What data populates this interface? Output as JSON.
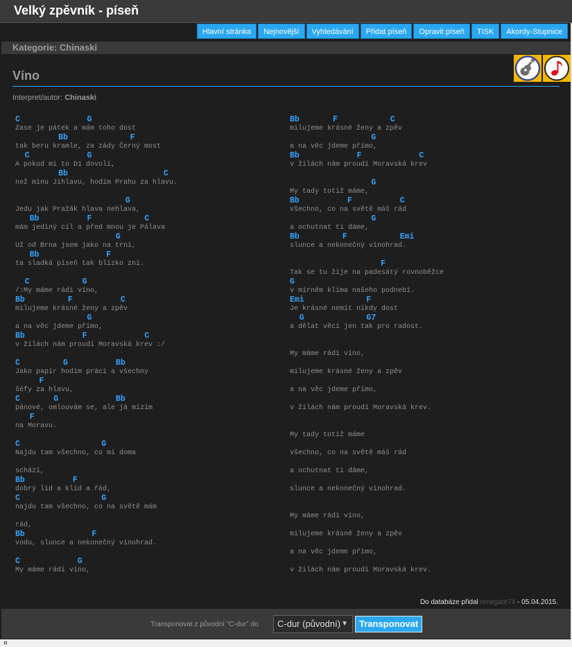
{
  "site": {
    "title": "Velký zpěvník - píseň"
  },
  "nav": [
    "Hlavní stránka",
    "Nejnovější",
    "Vyhledávání",
    "Přidat píseň",
    "Opravit píseň",
    "TISK",
    "Akordy-Stupnice"
  ],
  "category": {
    "label": "Kategorie:",
    "value": "Chinaski"
  },
  "song": {
    "title": "Víno",
    "artist_label": "Interpret/autor:",
    "artist": "Chinaski",
    "left": [
      {
        "t": "c",
        "s": "C              G"
      },
      {
        "t": "t",
        "s": "Zase je pátek a mám toho dost"
      },
      {
        "t": "c",
        "s": "         Bb             F"
      },
      {
        "t": "t",
        "s": "tak beru kramle, za zády Černý most"
      },
      {
        "t": "c",
        "s": "  C            G"
      },
      {
        "t": "t",
        "s": "A pokud mi to D1 dovolí,"
      },
      {
        "t": "c",
        "s": "         Bb                    C"
      },
      {
        "t": "t",
        "s": "než minu Jihlavu, hodím Prahu za hlavu."
      },
      {
        "t": "b"
      },
      {
        "t": "c",
        "s": "                       G"
      },
      {
        "t": "t",
        "s": "Jedu jak Pražák hlava nehlava,"
      },
      {
        "t": "c",
        "s": "   Bb          F           C"
      },
      {
        "t": "t",
        "s": "mám jediný cíl a před mnou je Pálava"
      },
      {
        "t": "c",
        "s": "                     G"
      },
      {
        "t": "t",
        "s": "Už od Brna jsem jako na trní,"
      },
      {
        "t": "c",
        "s": "   Bb              F"
      },
      {
        "t": "t",
        "s": "ta sladká píseň tak blízko zní."
      },
      {
        "t": "b"
      },
      {
        "t": "c",
        "s": "  C           G"
      },
      {
        "t": "t",
        "s": "/:My máme rádi víno,"
      },
      {
        "t": "c",
        "s": "Bb         F          C"
      },
      {
        "t": "t",
        "s": "milujeme krásné ženy a zpěv"
      },
      {
        "t": "c",
        "s": "               G"
      },
      {
        "t": "t",
        "s": "a na věc jdeme přímo,"
      },
      {
        "t": "c",
        "s": "Bb            F            C"
      },
      {
        "t": "t",
        "s": "v žilách nám proudí Moravská krev :/"
      },
      {
        "t": "b"
      },
      {
        "t": "c",
        "s": "C         G          Bb"
      },
      {
        "t": "t",
        "s": "Jako papír hodím práci a všechny"
      },
      {
        "t": "c",
        "s": "     F"
      },
      {
        "t": "t",
        "s": "šéfy za hlavu,"
      },
      {
        "t": "c",
        "s": "C       G            Bb"
      },
      {
        "t": "t",
        "s": "pánové, omlouvám se, ale já mizím"
      },
      {
        "t": "c",
        "s": "   F"
      },
      {
        "t": "t",
        "s": "na Moravu."
      },
      {
        "t": "b"
      },
      {
        "t": "c",
        "s": "C                 G"
      },
      {
        "t": "t",
        "s": "Najdu tam všechno, co mi doma"
      },
      {
        "t": "b"
      },
      {
        "t": "t",
        "s": "schází,"
      },
      {
        "t": "c",
        "s": "Bb          F"
      },
      {
        "t": "t",
        "s": "dobrý lid a klid a řád,"
      },
      {
        "t": "c",
        "s": "C                 G"
      },
      {
        "t": "t",
        "s": "najdu tam všechno, co na světě mám"
      },
      {
        "t": "b"
      },
      {
        "t": "t",
        "s": "rád,"
      },
      {
        "t": "c",
        "s": "Bb              F"
      },
      {
        "t": "t",
        "s": "vodu, slunce a nekonečný vinohrad."
      },
      {
        "t": "b"
      },
      {
        "t": "c",
        "s": "C            G"
      },
      {
        "t": "t",
        "s": "My máme rádi víno,"
      }
    ],
    "right": [
      {
        "t": "c",
        "s": "Bb       F           C"
      },
      {
        "t": "t",
        "s": "milujeme krásné ženy a zpěv"
      },
      {
        "t": "c",
        "s": "                 G"
      },
      {
        "t": "t",
        "s": "a na věc jdeme přímo,"
      },
      {
        "t": "c",
        "s": "Bb            F            C"
      },
      {
        "t": "t",
        "s": "v žilách nám proudí Moravská krev"
      },
      {
        "t": "b"
      },
      {
        "t": "c",
        "s": "                 G"
      },
      {
        "t": "t",
        "s": "My tady totiž máme,"
      },
      {
        "t": "c",
        "s": "Bb          F          C"
      },
      {
        "t": "t",
        "s": "všechno, co na světě máš rád"
      },
      {
        "t": "c",
        "s": "                 G"
      },
      {
        "t": "t",
        "s": "a ochutnat ti dáme,"
      },
      {
        "t": "c",
        "s": "Bb         F           Emi"
      },
      {
        "t": "t",
        "s": "slunce a nekonečný vinohrad."
      },
      {
        "t": "b"
      },
      {
        "t": "c",
        "s": "                   F"
      },
      {
        "t": "t",
        "s": "Tak se tu žije na padesátý rovnoběžce"
      },
      {
        "t": "c",
        "s": "G"
      },
      {
        "t": "t",
        "s": "v mírném klima našeho podnebí."
      },
      {
        "t": "c",
        "s": "Emi             F"
      },
      {
        "t": "t",
        "s": "Je krásné nemít nikdy dost"
      },
      {
        "t": "c",
        "s": "  G             G7"
      },
      {
        "t": "t",
        "s": "a dělat věci jen tak pro radost."
      },
      {
        "t": "b"
      },
      {
        "t": "b"
      },
      {
        "t": "t",
        "s": "My máme rádi víno,"
      },
      {
        "t": "b"
      },
      {
        "t": "t",
        "s": "milujeme krásné ženy a zpěv"
      },
      {
        "t": "b"
      },
      {
        "t": "t",
        "s": "a na věc jdeme přímo,"
      },
      {
        "t": "b"
      },
      {
        "t": "t",
        "s": "v žilách nám proudí Moravská krev."
      },
      {
        "t": "b"
      },
      {
        "t": "b"
      },
      {
        "t": "t",
        "s": "My tady totiž máme"
      },
      {
        "t": "b"
      },
      {
        "t": "t",
        "s": "všechno, co na světě máš rád"
      },
      {
        "t": "b"
      },
      {
        "t": "t",
        "s": "a ochutnat ti dáme,"
      },
      {
        "t": "b"
      },
      {
        "t": "t",
        "s": "slunce a nekonečný vinohrad."
      },
      {
        "t": "b"
      },
      {
        "t": "b"
      },
      {
        "t": "t",
        "s": "My máme rádi víno,"
      },
      {
        "t": "b"
      },
      {
        "t": "t",
        "s": "milujeme krásné ženy a zpěv"
      },
      {
        "t": "b"
      },
      {
        "t": "t",
        "s": "a na věc jdeme přímo,"
      },
      {
        "t": "b"
      },
      {
        "t": "t",
        "s": "v žilách nám proudí Moravská krev."
      }
    ]
  },
  "added": {
    "text": "Do databáze přidal",
    "user": "renegate74",
    "date": " - 05.04.2015."
  },
  "transpose": {
    "label": "Transponovat z původní \"C-dur\" do",
    "selected": "C-dur (původní)",
    "button": "Transponovat"
  },
  "colors": {
    "accent": "#2aa7f0",
    "chord": "#35a3ff",
    "background": "#1e1e1e",
    "icon_bg": "#f3b800"
  },
  "icons": [
    "guitar-icon",
    "music-note-icon",
    "chevron-down-icon"
  ]
}
